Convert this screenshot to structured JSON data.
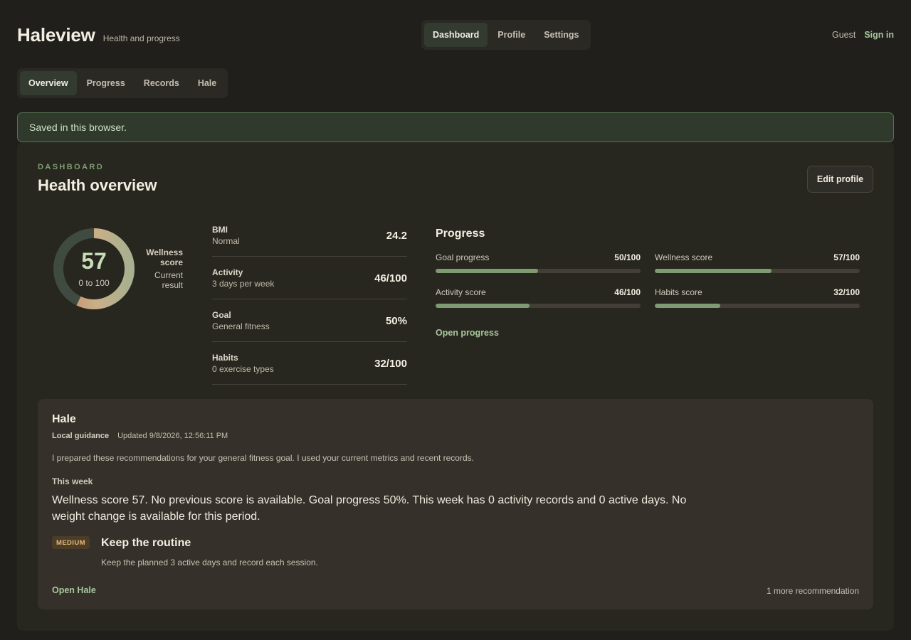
{
  "header": {
    "brand_title": "Haleview",
    "brand_subtitle": "Health and progress",
    "nav": [
      {
        "label": "Dashboard",
        "active": true
      },
      {
        "label": "Profile",
        "active": false
      },
      {
        "label": "Settings",
        "active": false
      }
    ],
    "guest_label": "Guest",
    "sign_in_label": "Sign in"
  },
  "subnav": [
    {
      "label": "Overview",
      "active": true
    },
    {
      "label": "Progress",
      "active": false
    },
    {
      "label": "Records",
      "active": false
    },
    {
      "label": "Hale",
      "active": false
    }
  ],
  "notice": "Saved in this browser.",
  "dashboard": {
    "eyebrow": "DASHBOARD",
    "title": "Health overview",
    "edit_label": "Edit profile",
    "wellness": {
      "score": "57",
      "score_value": 57,
      "range": "0 to 100",
      "label": "Wellness score",
      "sublabel": "Current result"
    },
    "metrics": [
      {
        "name": "BMI",
        "sub": "Normal",
        "value": "24.2"
      },
      {
        "name": "Activity",
        "sub": "3 days per week",
        "value": "46/100"
      },
      {
        "name": "Goal",
        "sub": "General fitness",
        "value": "50%"
      },
      {
        "name": "Habits",
        "sub": "0 exercise types",
        "value": "32/100"
      }
    ],
    "progress": {
      "title": "Progress",
      "bars": [
        {
          "name": "Goal progress",
          "value": "50/100",
          "fraction": 0.5
        },
        {
          "name": "Wellness score",
          "value": "57/100",
          "fraction": 0.57
        },
        {
          "name": "Activity score",
          "value": "46/100",
          "fraction": 0.46
        },
        {
          "name": "Habits score",
          "value": "32/100",
          "fraction": 0.32
        }
      ],
      "open_label": "Open progress"
    }
  },
  "hale": {
    "title": "Hale",
    "tag": "Local guidance",
    "updated": "Updated 9/8/2026, 12:56:11 PM",
    "intro": "I prepared these recommendations for your general fitness goal. I used your current metrics and recent records.",
    "week_label": "This week",
    "summary": "Wellness score 57. No previous score is available. Goal progress 50%. This week has 0 activity records and 0 active days. No weight change is available for this period.",
    "recommendation": {
      "badge": "MEDIUM",
      "title": "Keep the routine",
      "description": "Keep the planned 3 active days and record each session."
    },
    "open_label": "Open Hale",
    "more_label": "1 more recommendation"
  },
  "colors": {
    "accent_green": "#7e9b72",
    "link_green": "#a9c79d",
    "donut_orange": "#c9896a",
    "donut_tan": "#c9b089",
    "donut_sage": "#a7b08f",
    "donut_track": "#3f4a40",
    "badge_text": "#e7b97a"
  }
}
